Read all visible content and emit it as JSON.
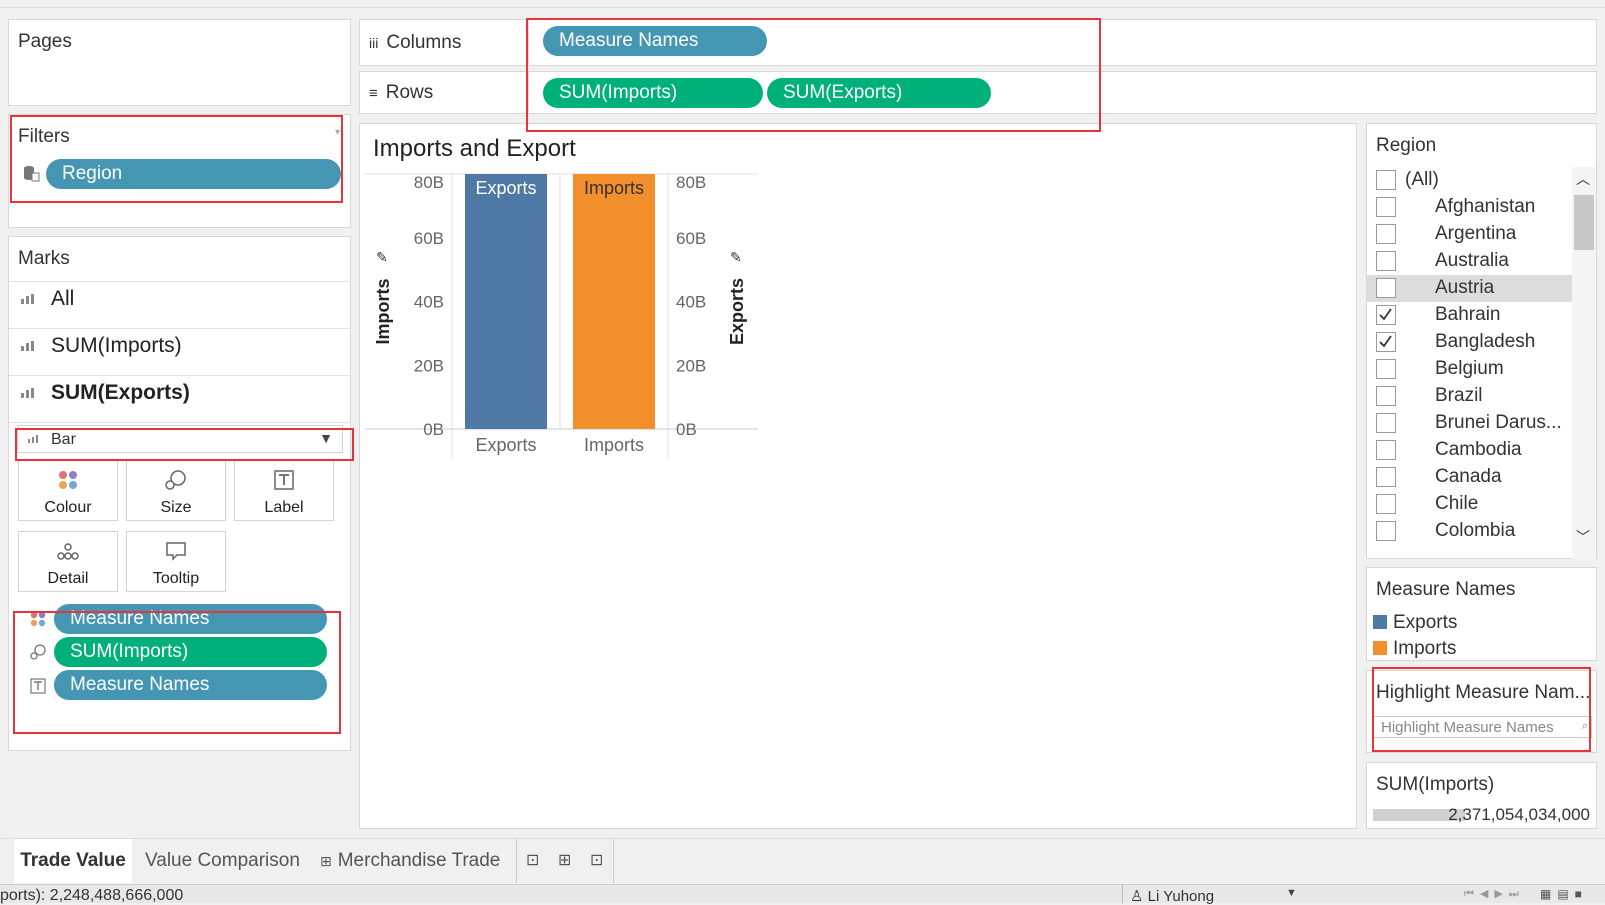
{
  "shelves": {
    "pages_title": "Pages",
    "filters_title": "Filters",
    "filter_pill": "Region",
    "columns_label": "Columns",
    "rows_label": "Rows",
    "columns_pills": [
      "Measure Names"
    ],
    "rows_pills": [
      "SUM(Imports)",
      "SUM(Exports)"
    ]
  },
  "marks": {
    "title": "Marks",
    "items": [
      "All",
      "SUM(Imports)",
      "SUM(Exports)"
    ],
    "mark_type": "Bar",
    "buttons": [
      "Colour",
      "Size",
      "Label",
      "Detail",
      "Tooltip"
    ],
    "pills": [
      "Measure Names",
      "SUM(Imports)",
      "Measure Names"
    ]
  },
  "chart_data": {
    "type": "bar",
    "title": "Imports and Export",
    "categories": [
      "Exports",
      "Imports"
    ],
    "series": [
      {
        "name": "SUM(Imports)",
        "values": [
          80,
          80
        ]
      },
      {
        "name": "SUM(Exports)",
        "values": [
          80,
          80
        ]
      }
    ],
    "bar_labels": [
      "Exports",
      "Imports"
    ],
    "colors": [
      "#4e79a7",
      "#f28e2b"
    ],
    "ylabel_left": "Imports",
    "ylabel_right": "Exports",
    "ylim": [
      0,
      80
    ],
    "y_ticks": [
      "80B",
      "60B",
      "40B",
      "20B",
      "0B"
    ],
    "grid": false
  },
  "region_filter": {
    "title": "Region",
    "items": [
      {
        "label": "(All)",
        "checked": false
      },
      {
        "label": "Afghanistan",
        "checked": false
      },
      {
        "label": "Argentina",
        "checked": false
      },
      {
        "label": "Australia",
        "checked": false
      },
      {
        "label": "Austria",
        "checked": false
      },
      {
        "label": "Bahrain",
        "checked": true
      },
      {
        "label": "Bangladesh",
        "checked": true
      },
      {
        "label": "Belgium",
        "checked": false
      },
      {
        "label": "Brazil",
        "checked": false
      },
      {
        "label": "Brunei Darus...",
        "checked": false
      },
      {
        "label": "Cambodia",
        "checked": false
      },
      {
        "label": "Canada",
        "checked": false
      },
      {
        "label": "Chile",
        "checked": false
      },
      {
        "label": "Colombia",
        "checked": false
      }
    ]
  },
  "legend": {
    "title": "Measure Names",
    "items": [
      {
        "label": "Exports",
        "color": "#4e79a7"
      },
      {
        "label": "Imports",
        "color": "#f28e2b"
      }
    ]
  },
  "highlighter": {
    "title": "Highlight Measure Nam...",
    "placeholder": "Highlight Measure Names"
  },
  "size_legend": {
    "title": "SUM(Imports)",
    "value": "2,371,054,034,000"
  },
  "tabs": [
    "Trade Value",
    "Value Comparison",
    "Merchandise Trade"
  ],
  "status_bar": {
    "text": "ports): 2,248,488,666,000",
    "user": "Li Yuhong"
  }
}
